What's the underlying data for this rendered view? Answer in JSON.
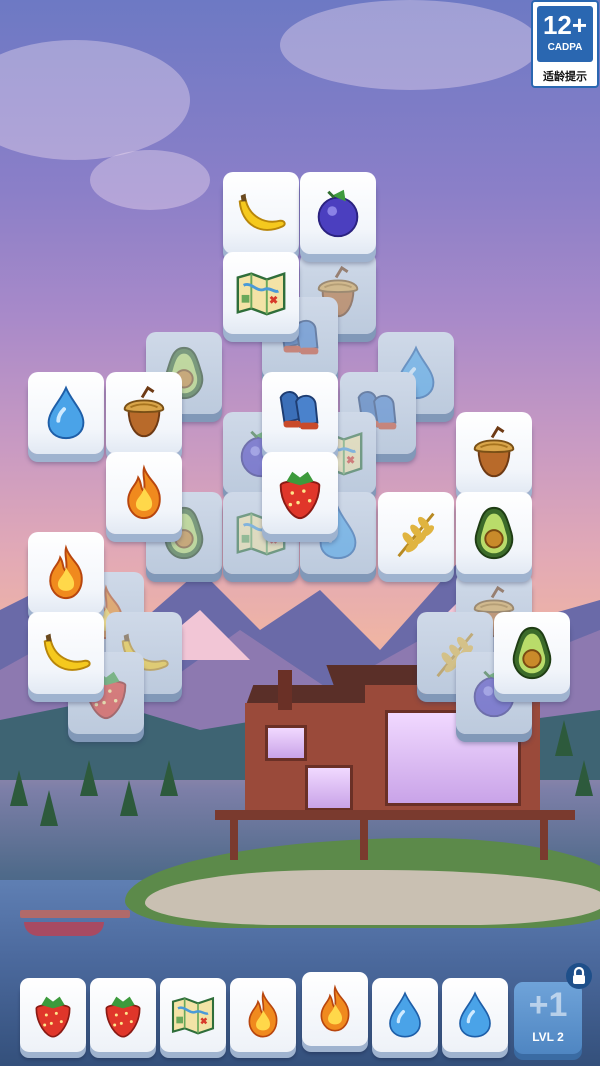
{
  "age_rating": {
    "number": "12+",
    "org": "CADPA",
    "hint": "适龄提示"
  },
  "tray": {
    "locked_label": "LVL 2",
    "locked_plus": "+1"
  },
  "board_tiles": [
    {
      "icon": "banana",
      "state": "active"
    },
    {
      "icon": "blueberry",
      "state": "active"
    },
    {
      "icon": "map",
      "state": "active"
    },
    {
      "icon": "acorn",
      "state": "blocked"
    },
    {
      "icon": "mittens",
      "state": "blocked"
    },
    {
      "icon": "avocado",
      "state": "blocked"
    },
    {
      "icon": "water-drop",
      "state": "blocked"
    },
    {
      "icon": "water-drop",
      "state": "active"
    },
    {
      "icon": "acorn",
      "state": "active"
    },
    {
      "icon": "mittens",
      "state": "active"
    },
    {
      "icon": "mittens",
      "state": "blocked"
    },
    {
      "icon": "acorn",
      "state": "active"
    },
    {
      "icon": "fire",
      "state": "active"
    },
    {
      "icon": "strawberry",
      "state": "active"
    },
    {
      "icon": "blueberry",
      "state": "blocked"
    },
    {
      "icon": "map",
      "state": "blocked"
    },
    {
      "icon": "avocado",
      "state": "blocked"
    },
    {
      "icon": "map",
      "state": "blocked"
    },
    {
      "icon": "water-drop",
      "state": "blocked"
    },
    {
      "icon": "wheat",
      "state": "active"
    },
    {
      "icon": "avocado",
      "state": "active"
    },
    {
      "icon": "fire",
      "state": "active"
    },
    {
      "icon": "fire",
      "state": "blocked"
    },
    {
      "icon": "banana",
      "state": "blocked"
    },
    {
      "icon": "banana",
      "state": "active"
    },
    {
      "icon": "strawberry",
      "state": "blocked"
    },
    {
      "icon": "acorn",
      "state": "blocked"
    },
    {
      "icon": "wheat",
      "state": "blocked"
    },
    {
      "icon": "avocado",
      "state": "active"
    },
    {
      "icon": "blueberry",
      "state": "blocked"
    }
  ],
  "collection_slots": [
    {
      "icon": "strawberry"
    },
    {
      "icon": "strawberry"
    },
    {
      "icon": "map"
    },
    {
      "icon": "fire"
    },
    {
      "icon": "fire"
    },
    {
      "icon": "water-drop"
    },
    {
      "icon": "water-drop"
    }
  ],
  "colors": {
    "tile_face": "#ffffff",
    "tile_edge": "#9fb3cf",
    "locked_slot": "#4f86c2",
    "badge_blue": "#2a67b1"
  }
}
